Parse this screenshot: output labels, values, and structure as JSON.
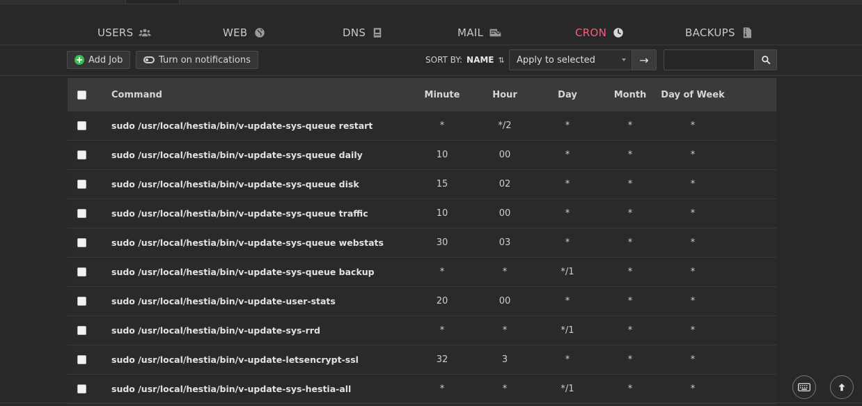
{
  "nav": {
    "tabs": [
      {
        "label": "USERS",
        "icon": "users-icon"
      },
      {
        "label": "WEB",
        "icon": "globe-icon"
      },
      {
        "label": "DNS",
        "icon": "book-icon"
      },
      {
        "label": "MAIL",
        "icon": "mail-icon"
      },
      {
        "label": "CRON",
        "icon": "clock-icon",
        "active": true
      },
      {
        "label": "BACKUPS",
        "icon": "file-archive-icon"
      }
    ],
    "active_color": "#ff5a7a"
  },
  "toolbar": {
    "add_job_label": "Add Job",
    "notifications_label": "Turn on notifications",
    "sort_by_label": "SORT BY:",
    "sort_by_value": "NAME",
    "bulk_action_selected": "Apply to selected",
    "search_placeholder": ""
  },
  "table": {
    "headers": {
      "command": "Command",
      "minute": "Minute",
      "hour": "Hour",
      "day": "Day",
      "month": "Month",
      "dow": "Day of Week"
    },
    "rows": [
      {
        "command": "sudo /usr/local/hestia/bin/v-update-sys-queue restart",
        "minute": "*",
        "hour": "*/2",
        "day": "*",
        "month": "*",
        "dow": "*"
      },
      {
        "command": "sudo /usr/local/hestia/bin/v-update-sys-queue daily",
        "minute": "10",
        "hour": "00",
        "day": "*",
        "month": "*",
        "dow": "*"
      },
      {
        "command": "sudo /usr/local/hestia/bin/v-update-sys-queue disk",
        "minute": "15",
        "hour": "02",
        "day": "*",
        "month": "*",
        "dow": "*"
      },
      {
        "command": "sudo /usr/local/hestia/bin/v-update-sys-queue traffic",
        "minute": "10",
        "hour": "00",
        "day": "*",
        "month": "*",
        "dow": "*"
      },
      {
        "command": "sudo /usr/local/hestia/bin/v-update-sys-queue webstats",
        "minute": "30",
        "hour": "03",
        "day": "*",
        "month": "*",
        "dow": "*"
      },
      {
        "command": "sudo /usr/local/hestia/bin/v-update-sys-queue backup",
        "minute": "*",
        "hour": "*",
        "day": "*/1",
        "month": "*",
        "dow": "*"
      },
      {
        "command": "sudo /usr/local/hestia/bin/v-update-user-stats",
        "minute": "20",
        "hour": "00",
        "day": "*",
        "month": "*",
        "dow": "*"
      },
      {
        "command": "sudo /usr/local/hestia/bin/v-update-sys-rrd",
        "minute": "*",
        "hour": "*",
        "day": "*/1",
        "month": "*",
        "dow": "*"
      },
      {
        "command": "sudo /usr/local/hestia/bin/v-update-letsencrypt-ssl",
        "minute": "32",
        "hour": "3",
        "day": "*",
        "month": "*",
        "dow": "*"
      },
      {
        "command": "sudo /usr/local/hestia/bin/v-update-sys-hestia-all",
        "minute": "*",
        "hour": "*",
        "day": "*/1",
        "month": "*",
        "dow": "*"
      }
    ]
  }
}
